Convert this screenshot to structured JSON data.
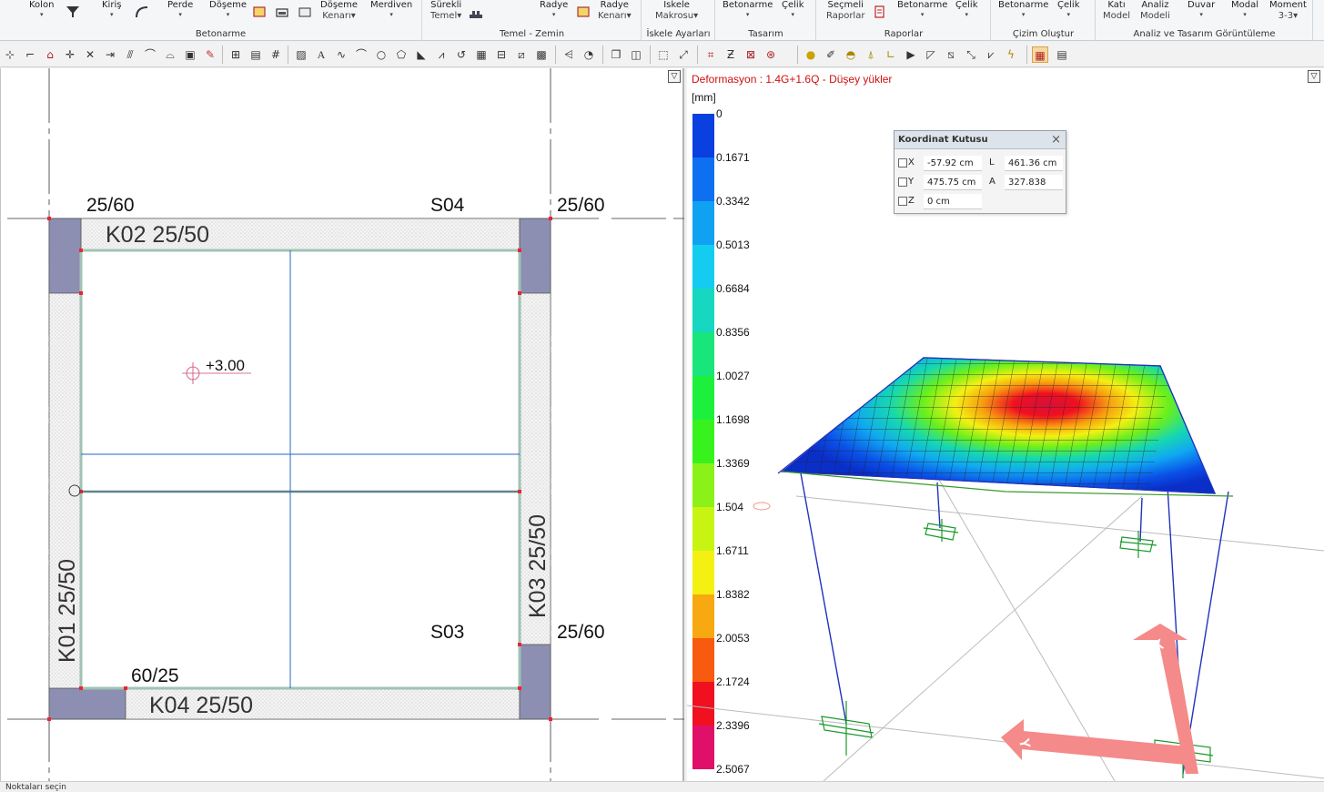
{
  "ribbon": {
    "groups": [
      {
        "label": "Betonarme",
        "buttons": [
          {
            "label1": "Kolon",
            "label2": "▾"
          },
          {
            "label1": "Kiriş",
            "label2": "▾"
          },
          {
            "label1": "Perde",
            "label2": "▾"
          },
          {
            "label1": "Döşeme",
            "label2": "▾"
          },
          {
            "label1": "Döşeme",
            "label2": "Kenarı▾"
          },
          {
            "label1": "Merdiven",
            "label2": "▾"
          }
        ]
      },
      {
        "label": "Temel - Zemin",
        "buttons": [
          {
            "label1": "Sürekli",
            "label2": "Temel▾"
          },
          {
            "label1": "Radye",
            "label2": "▾"
          },
          {
            "label1": "Radye",
            "label2": "Kenarı▾"
          }
        ]
      },
      {
        "label": "İskele Ayarları",
        "buttons": [
          {
            "label1": "İskele",
            "label2": "Makrosu▾"
          }
        ]
      },
      {
        "label": "Tasarım",
        "buttons": [
          {
            "label1": "Betonarme",
            "label2": "▾"
          },
          {
            "label1": "Çelik",
            "label2": "▾"
          }
        ]
      },
      {
        "label": "Raporlar",
        "buttons": [
          {
            "label1": "Seçmeli",
            "label2": "Raporlar"
          },
          {
            "label1": "Betonarme",
            "label2": "▾"
          },
          {
            "label1": "Çelik",
            "label2": "▾"
          }
        ]
      },
      {
        "label": "Çizim Oluştur",
        "buttons": [
          {
            "label1": "Betonarme",
            "label2": "▾"
          },
          {
            "label1": "Çelik",
            "label2": "▾"
          }
        ]
      },
      {
        "label": "Analiz ve Tasarım Görüntüleme",
        "buttons": [
          {
            "label1": "Katı",
            "label2": "Model"
          },
          {
            "label1": "Analiz",
            "label2": "Modeli"
          },
          {
            "label1": "Duvar",
            "label2": "▾"
          },
          {
            "label1": "Modal",
            "label2": "▾"
          },
          {
            "label1": "Moment",
            "label2": "3-3▾"
          }
        ]
      }
    ]
  },
  "plan": {
    "labels": {
      "col_tl": "25/60",
      "col_tr": "25/60",
      "col_br": "25/60",
      "col_bl": "60/25",
      "s04": "S04",
      "s03": "S03",
      "k01": "K01 25/50",
      "k02": "K02 25/50",
      "k03": "K03 25/50",
      "k04": "K04 25/50",
      "elev": "+3.00"
    }
  },
  "view3d": {
    "title": "Deformasyon : 1.4G+1.6Q  -  Düşey yükler",
    "unit": "[mm]",
    "legend": [
      "0",
      "0.1671",
      "0.3342",
      "0.5013",
      "0.6684",
      "0.8356",
      "1.0027",
      "1.1698",
      "1.3369",
      "1.504",
      "1.6711",
      "1.8382",
      "2.0053",
      "2.1724",
      "2.3396",
      "2.5067"
    ],
    "legend_colors": [
      "#1230a8",
      "#0a3fe0",
      "#0e70f0",
      "#10a2f2",
      "#14ccf0",
      "#16d8c0",
      "#18e67a",
      "#1cf03c",
      "#38f21e",
      "#8af218",
      "#c8f414",
      "#f4f012",
      "#f8a810",
      "#f85a10",
      "#f01020",
      "#e0106a"
    ],
    "axis_x": "X",
    "axis_y": "Y"
  },
  "coord_box": {
    "title": "Koordinat Kutusu",
    "close": "×",
    "rows": [
      {
        "axis": "X",
        "value": "-57.92 cm",
        "label2": "L",
        "value2": "461.36 cm"
      },
      {
        "axis": "Y",
        "value": "475.75 cm",
        "label2": "A",
        "value2": "327.838"
      },
      {
        "axis": "Z",
        "value": "0 cm",
        "label2": "",
        "value2": ""
      }
    ]
  },
  "status": {
    "text": "Noktaları seçin"
  }
}
